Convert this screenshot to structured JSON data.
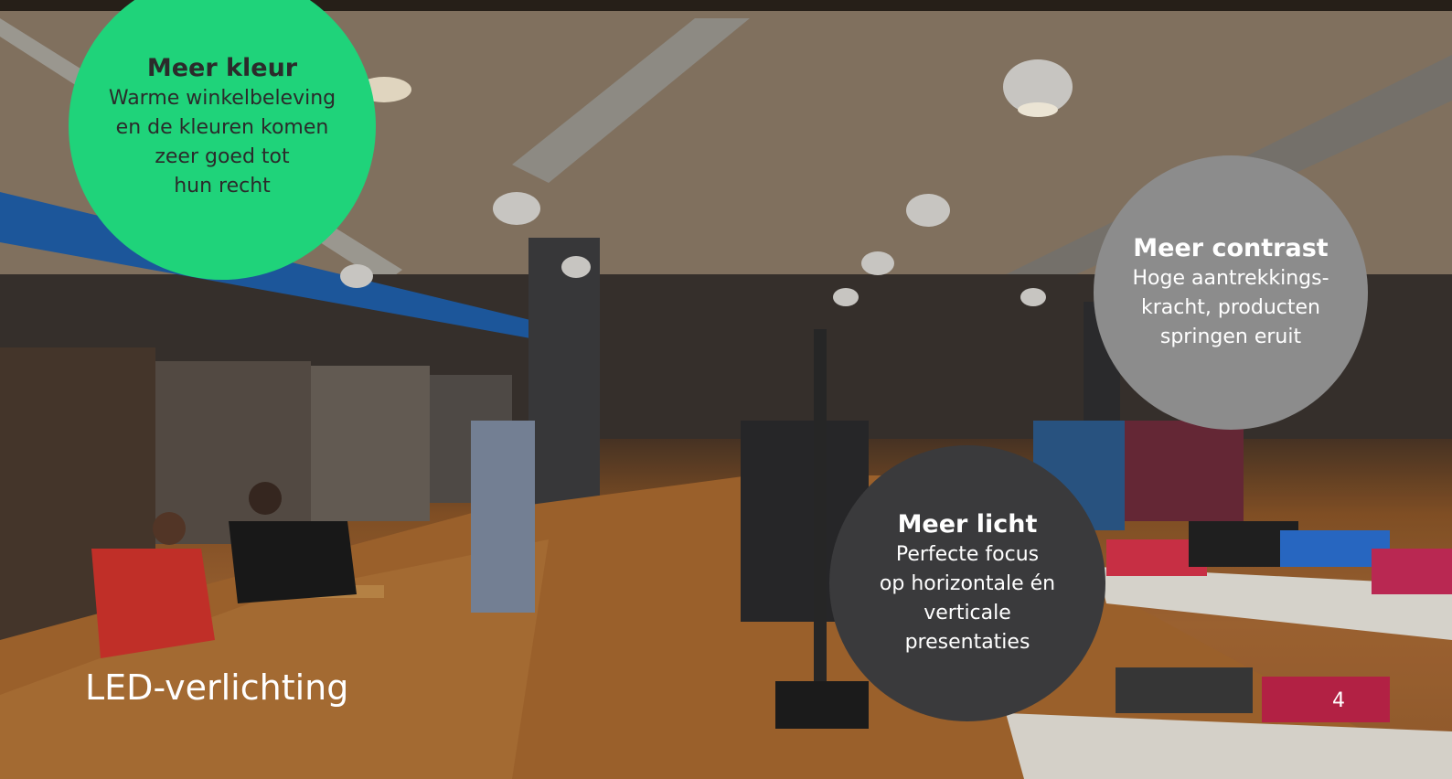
{
  "bubbles": {
    "kleur": {
      "title": "Meer kleur",
      "text": "Warme winkelbeleving\nen de kleuren komen\nzeer goed tot\nhun recht",
      "color": "#1fd37a"
    },
    "contrast": {
      "title": "Meer contrast",
      "text": "Hoge aantrekkings-\nkracht, producten\nspringen eruit",
      "color": "#8c8c8c"
    },
    "licht": {
      "title": "Meer licht",
      "text": "Perfecte focus\nop horizontale én\nverticale\npresentaties",
      "color": "#3a3a3c"
    }
  },
  "caption": "LED-verlichting",
  "page_number": "4"
}
